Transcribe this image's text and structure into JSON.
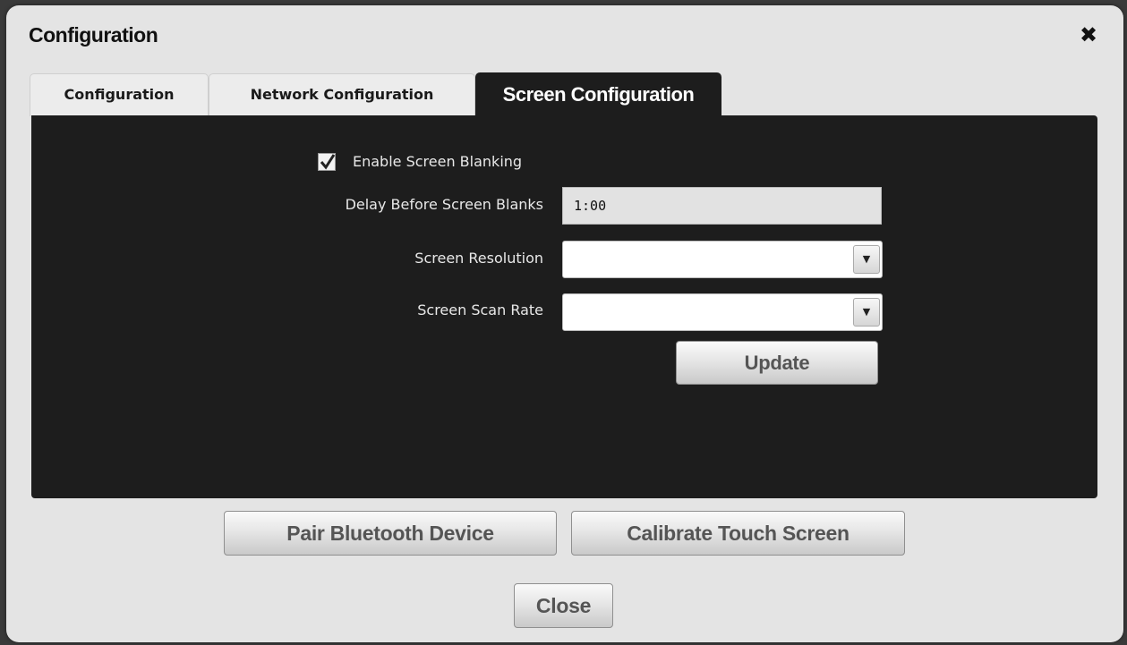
{
  "dialog": {
    "title": "Configuration",
    "close_glyph": "✖",
    "close_icon": "close-icon"
  },
  "tabs": [
    {
      "label": "Configuration",
      "active": false
    },
    {
      "label": "Network Configuration",
      "active": false
    },
    {
      "label": "Screen Configuration",
      "active": true
    }
  ],
  "screen": {
    "enable_blanking": {
      "label": "Enable Screen Blanking",
      "checked": true
    },
    "delay": {
      "label": "Delay Before Screen Blanks",
      "value": "1:00"
    },
    "resolution": {
      "label": "Screen Resolution",
      "value": ""
    },
    "scan_rate": {
      "label": "Screen Scan Rate",
      "value": ""
    },
    "dropdown_glyph": "▼",
    "update_label": "Update"
  },
  "footer": {
    "pair_label": "Pair Bluetooth Device",
    "calibrate_label": "Calibrate Touch Screen",
    "close_label": "Close"
  },
  "colors": {
    "dialog_bg": "#e4e4e4",
    "panel_bg": "#1d1d1d",
    "panel_text": "#e8e8e8"
  }
}
